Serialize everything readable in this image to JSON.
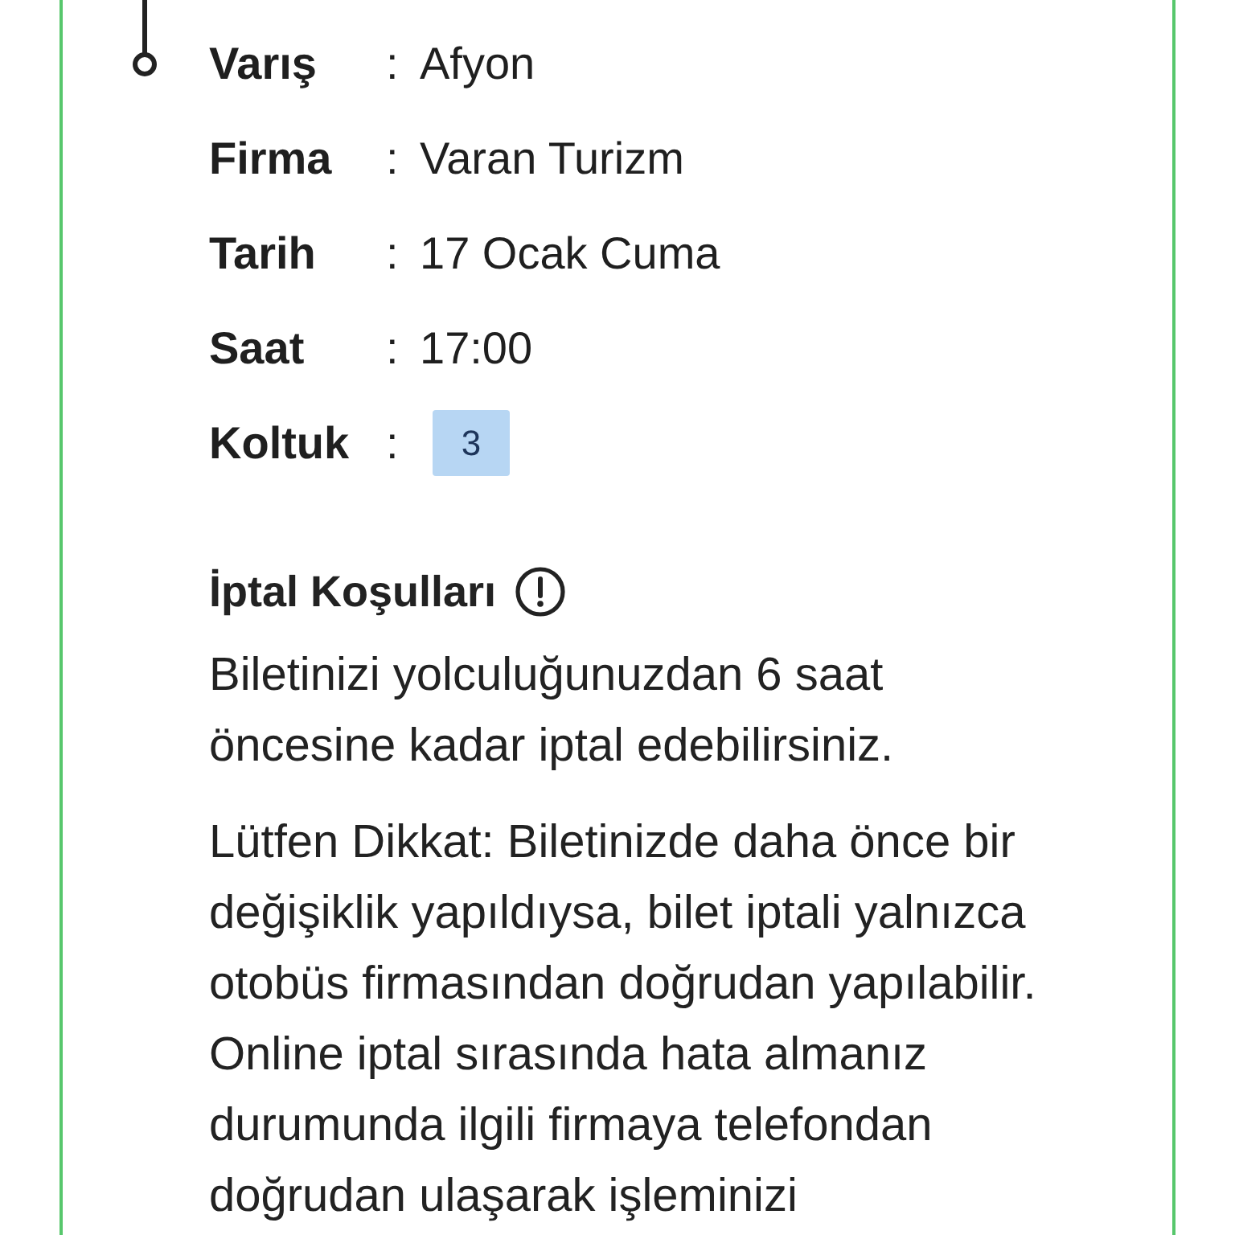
{
  "trip_details": [
    {
      "kind": "text",
      "label": "Varış",
      "separator": ":",
      "value": "Afyon"
    },
    {
      "kind": "text",
      "label": "Firma",
      "separator": ":",
      "value": "Varan Turizm"
    },
    {
      "kind": "text",
      "label": "Tarih",
      "separator": ":",
      "value": "17 Ocak Cuma"
    },
    {
      "kind": "text",
      "label": "Saat",
      "separator": ":",
      "value": "17:00"
    },
    {
      "kind": "seat",
      "label": "Koltuk",
      "separator": ":",
      "value": "3"
    }
  ],
  "cancellation": {
    "title": "İptal Koşulları",
    "paragraphs": [
      "Biletinizi yolculuğunuzdan 6 saat öncesine kadar iptal edebilirsiniz.",
      "Lütfen Dikkat: Biletinizde daha önce bir değişiklik yapıldıysa, bilet iptali yalnızca otobüs firmasından doğrudan yapılabilir. Online iptal sırasında hata almanız durumunda ilgili firmaya telefondan doğrudan ulaşarak işleminizi"
    ]
  }
}
